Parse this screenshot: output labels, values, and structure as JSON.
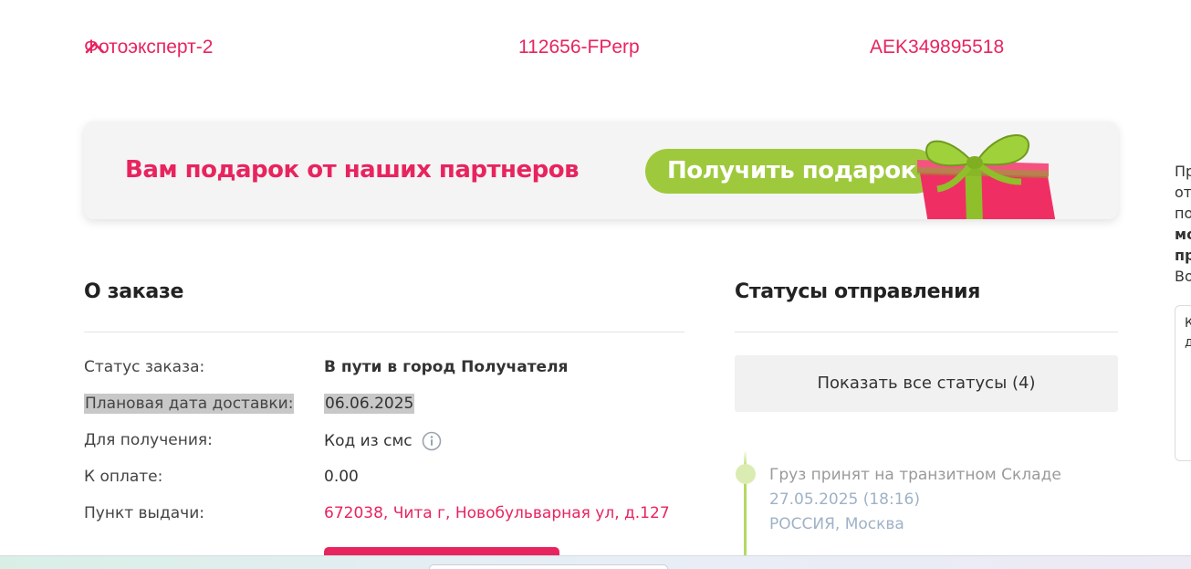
{
  "order_header": {
    "company": "Фотоэксперт-2",
    "invoice_number": "112656-FPerp",
    "tracking_number": "AEK349895518",
    "collapse_icon": "chevron-up-icon"
  },
  "banner": {
    "title": "Вам подарок от наших партнеров",
    "button_label": "Получить подарок",
    "image_icon": "gift-box-icon",
    "colors": {
      "title": "#e8245f",
      "button": "#9fc93c",
      "gift_box": "#ef2f63",
      "ribbon": "#8fbf2a"
    }
  },
  "order": {
    "title": "О заказе",
    "rows": [
      {
        "label": "Статус заказа:",
        "value": "В пути в город Получателя"
      },
      {
        "label": "Плановая дата доставки:",
        "value": "06.06.2025"
      },
      {
        "label": "Для получения:",
        "value": "Код из смс"
      },
      {
        "label": "К оплате:",
        "value": "0.00"
      },
      {
        "label": "Пункт выдачи:",
        "value": "672038, Чита г, Новобульварная ул, д.127"
      }
    ],
    "info_icon": "info-icon"
  },
  "statuses": {
    "title": "Статусы отправления",
    "show_all_label": "Показать все статусы (4)",
    "events": [
      {
        "event": "Груз принят на транзитном Складе",
        "datetime": "27.05.2025 (18:16)",
        "place": "РОССИЯ, Москва"
      }
    ]
  },
  "side_panel": {
    "lines": [
      "Пр",
      "от",
      "по",
      "мо",
      "пр",
      "Во"
    ],
    "box_lines": [
      "К",
      "д"
    ]
  },
  "colors": {
    "accent": "#e8245f",
    "success": "#9fc93c",
    "timeline": "#b5d964"
  }
}
